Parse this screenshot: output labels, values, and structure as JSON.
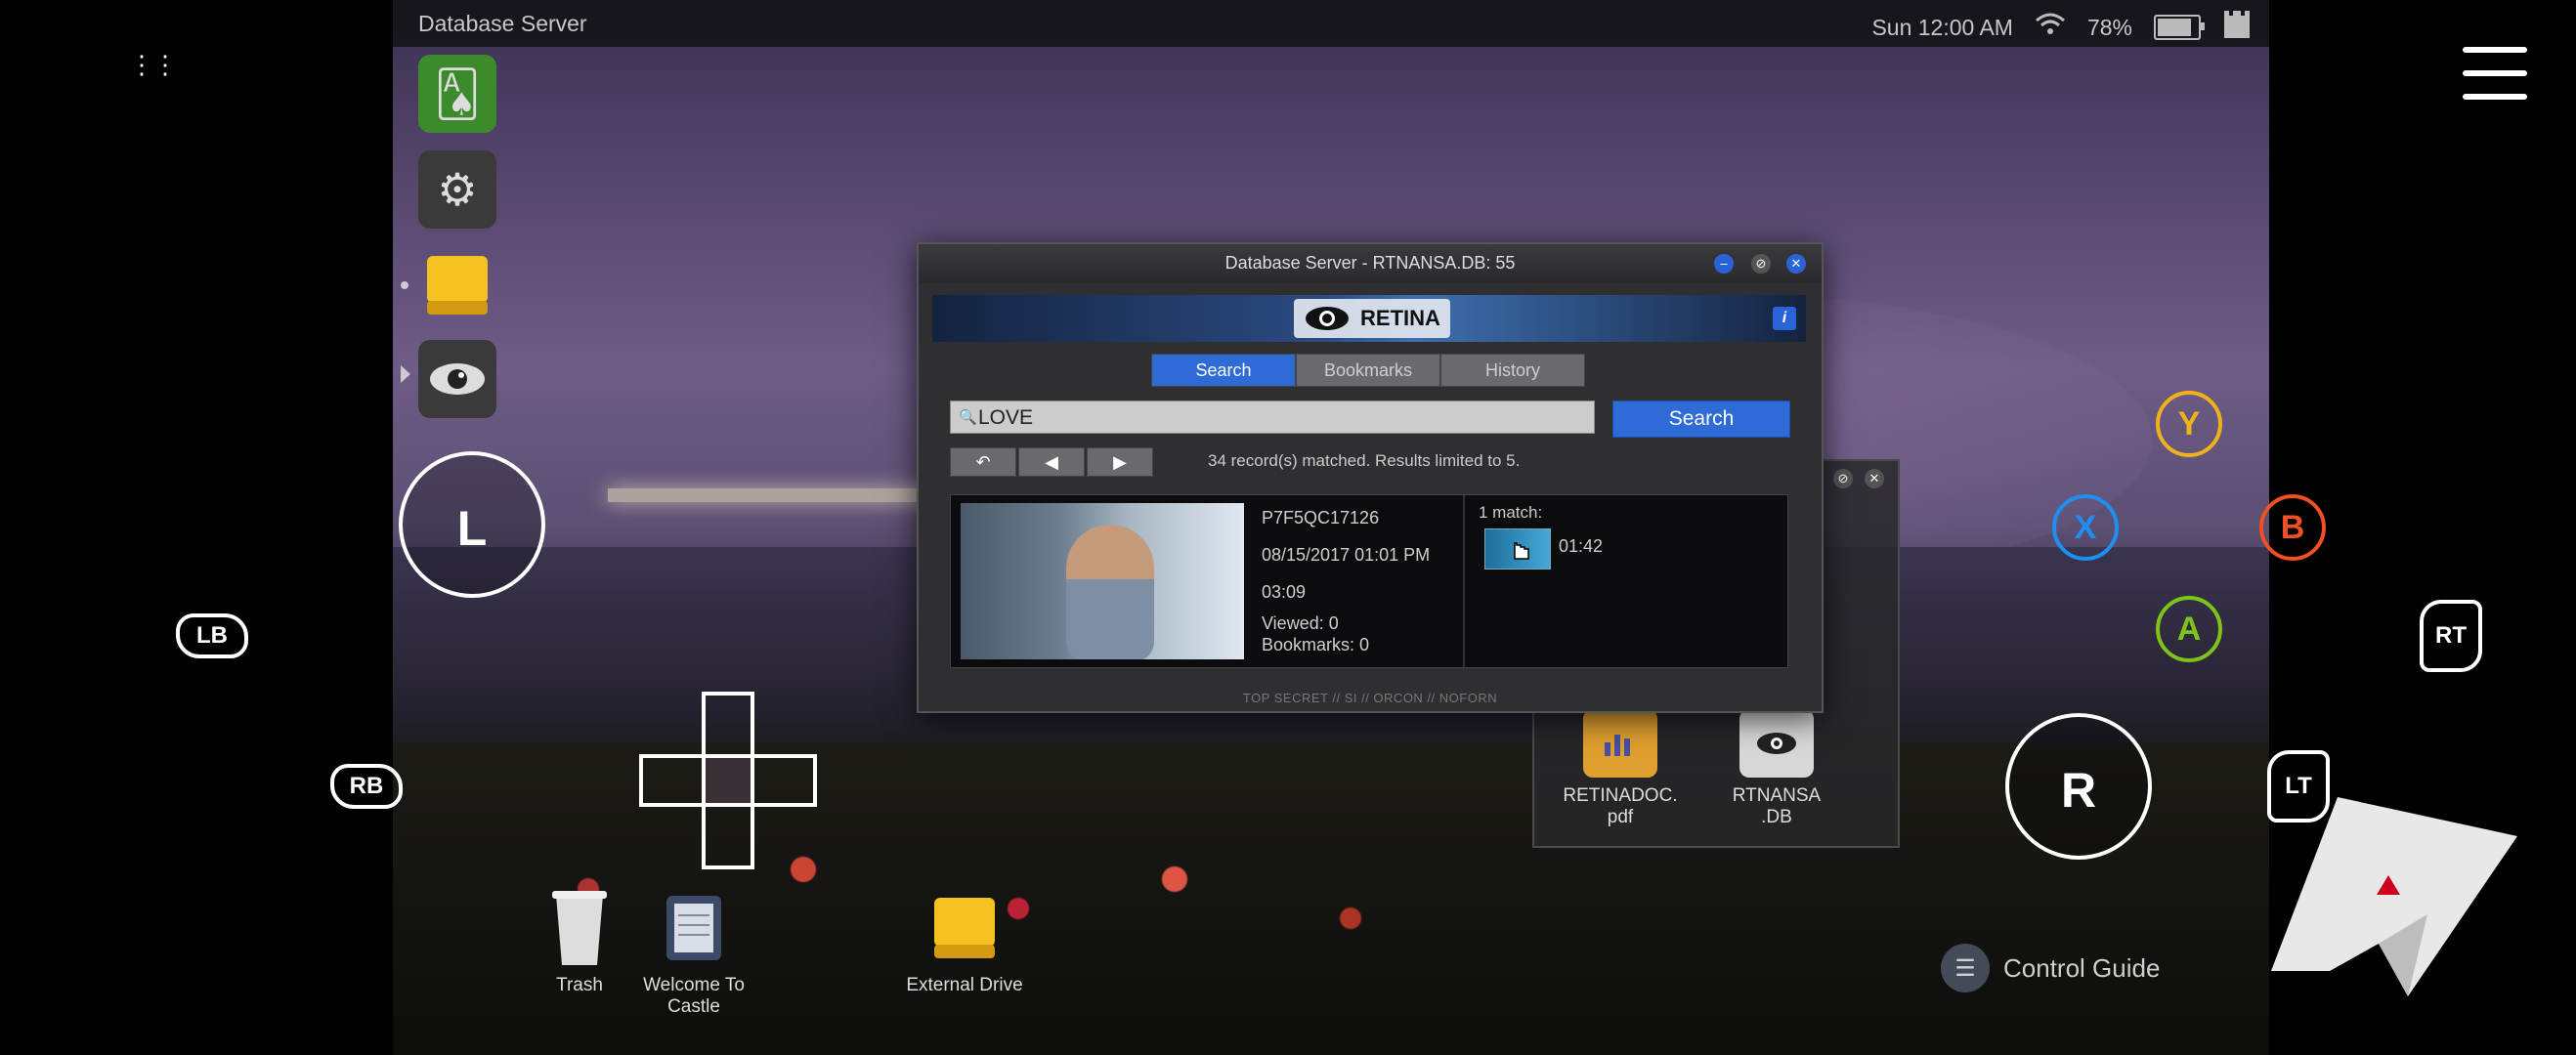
{
  "topbar": {
    "title": "Database Server",
    "datetime": "Sun 12:00 AM",
    "battery_text": "78%",
    "battery_level": 0.78,
    "wifi_icon": "wifi-icon",
    "castle_icon": "castle-icon"
  },
  "dock": {
    "items": [
      "solitaire-icon",
      "settings-gears-icon",
      "drive-icon",
      "retina-eye-icon"
    ]
  },
  "main_window": {
    "title": "Database Server - RTNANSA.DB: 55",
    "brand": "RETINA",
    "info": "i",
    "tabs": [
      "Search",
      "Bookmarks",
      "History"
    ],
    "active_tab": "Search",
    "search_value": "LOVE",
    "search_button": "Search",
    "result_count": "34 record(s) matched. Results limited to 5.",
    "result": {
      "id": "P7F5QC17126",
      "date": "08/15/2017 01:01 PM",
      "duration": "03:09",
      "viewed": "Viewed: 0",
      "bookmarks": "Bookmarks: 0",
      "match_label": "1 match:",
      "match_time": "01:42"
    },
    "classification": "TOP SECRET // SI // ORCON // NOFORN"
  },
  "sub_window": {
    "files": [
      {
        "name_line1": "RETINADOC.",
        "name_line2": "pdf",
        "icon": "document-chart-icon",
        "color": "#e0a030"
      },
      {
        "name_line1": "RTNANSA",
        "name_line2": ".DB",
        "icon": "database-eye-icon",
        "color": "#d8d8d8"
      }
    ]
  },
  "desktop_icons": [
    {
      "line1": "Trash",
      "line2": "",
      "icon": "trash-icon"
    },
    {
      "line1": "Welcome To",
      "line2": "Castle",
      "icon": "notes-icon"
    },
    {
      "line1": "External Drive",
      "line2": "",
      "icon": "external-drive-icon"
    }
  ],
  "control_guide": {
    "label": "Control Guide"
  },
  "controller": {
    "left_stick": "L",
    "right_stick": "R",
    "lb": "LB",
    "rb": "RB",
    "rt": "RT",
    "lt": "LT",
    "y": "Y",
    "x": "X",
    "b": "B",
    "a": "A",
    "colors": {
      "y": "#f0b21c",
      "x": "#1e8ff0",
      "b": "#f05024",
      "a": "#7cc41a"
    }
  }
}
